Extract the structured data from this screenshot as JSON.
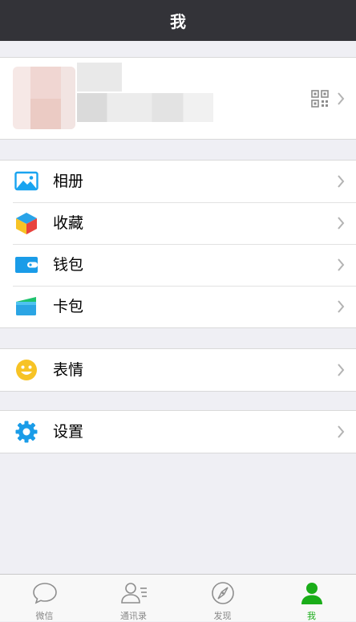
{
  "header": {
    "title": "我"
  },
  "menu_groups": [
    {
      "items": [
        {
          "label": "相册"
        },
        {
          "label": "收藏"
        },
        {
          "label": "钱包"
        },
        {
          "label": "卡包"
        }
      ]
    },
    {
      "items": [
        {
          "label": "表情"
        }
      ]
    },
    {
      "items": [
        {
          "label": "设置"
        }
      ]
    }
  ],
  "tabs": [
    {
      "label": "微信",
      "icon": "chat-bubble-icon",
      "active": false
    },
    {
      "label": "通讯录",
      "icon": "contacts-icon",
      "active": false
    },
    {
      "label": "发现",
      "icon": "compass-icon",
      "active": false
    },
    {
      "label": "我",
      "icon": "person-icon",
      "active": true
    }
  ],
  "colors": {
    "accent": "#1aad19",
    "header_bg": "#333338",
    "page_bg": "#efeff4"
  }
}
